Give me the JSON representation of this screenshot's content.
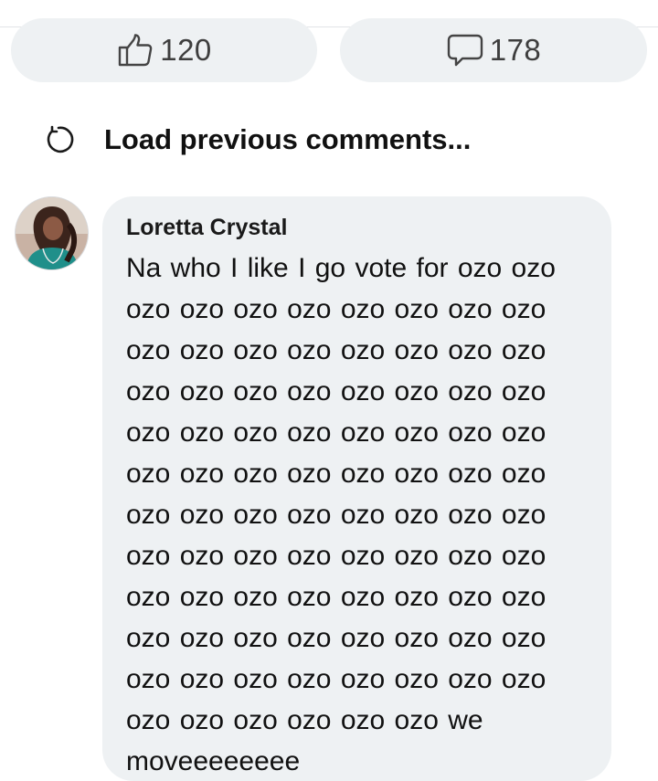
{
  "actions": {
    "like_count": "120",
    "comment_count": "178",
    "like_icon": "thumbs-up-icon",
    "comment_icon": "speech-bubble-icon"
  },
  "load_previous": {
    "label": "Load previous comments...",
    "icon": "reload-icon"
  },
  "comment": {
    "author": "Loretta Crystal",
    "text": "Na who I like I go vote for ozo ozo ozo ozo ozo ozo ozo ozo ozo ozo ozo ozo ozo ozo ozo ozo ozo ozo ozo ozo ozo ozo ozo ozo ozo ozo ozo ozo ozo ozo ozo ozo ozo ozo ozo ozo ozo ozo ozo ozo ozo ozo ozo ozo ozo ozo ozo ozo ozo ozo ozo ozo ozo ozo ozo ozo ozo ozo ozo ozo ozo ozo ozo ozo ozo ozo ozo ozo ozo ozo ozo ozo ozo ozo ozo ozo ozo ozo ozo ozo ozo ozo ozo ozo ozo ozo ozo ozo we moveeeeeeee",
    "avatar_icon": "avatar"
  },
  "colors": {
    "pill_background": "#eef1f3",
    "bubble_background": "#eef1f3",
    "text": "#111111",
    "count_text": "#3e3e3e"
  }
}
